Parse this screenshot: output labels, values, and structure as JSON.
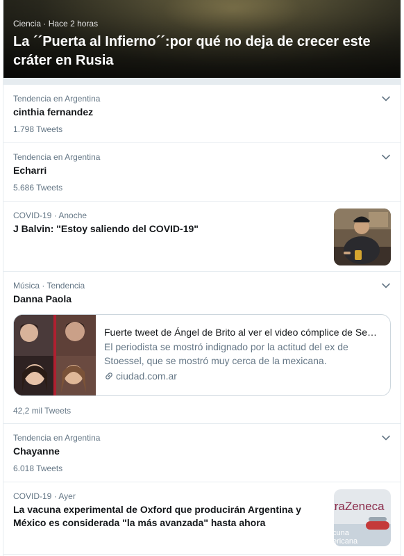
{
  "hero": {
    "category": "Ciencia",
    "separator": "·",
    "time": "Hace 2 horas",
    "title": "La ´´Puerta al Infierno´´:por qué no deja de crecer este cráter en Rusia"
  },
  "trends": [
    {
      "context": "Tendencia en Argentina",
      "name": "cinthia fernandez",
      "tweets": "1.798 Tweets",
      "icon": "chevron-down-icon"
    },
    {
      "context": "Tendencia en Argentina",
      "name": "Echarri",
      "tweets": "5.686 Tweets",
      "icon": "chevron-down-icon"
    }
  ],
  "news1": {
    "category": "COVID-19",
    "separator": "·",
    "time": "Anoche",
    "title": "J Balvin: \"Estoy saliendo del COVID-19\""
  },
  "trend_music": {
    "context": "Música · Tendencia",
    "name": "Danna Paola",
    "tweets": "42,2 mil Tweets",
    "card": {
      "title": "Fuerte tweet de Ángel de Brito al ver el video cómplice de Se…",
      "description": "El periodista se mostró indignado por la actitud del ex de Stoessel, que se mostró muy cerca de la mexicana.",
      "link": "ciudad.com.ar",
      "link_icon": "link-icon"
    }
  },
  "trend_last": {
    "context": "Tendencia en Argentina",
    "name": "Chayanne",
    "tweets": "6.018 Tweets"
  },
  "news2": {
    "category": "COVID-19",
    "separator": "·",
    "time": "Ayer",
    "title": "La vacuna experimental de Oxford que producirán Argentina y México es considerada \"la más avanzada\" hasta ahora",
    "thumb_text_1": "traZeneca",
    "thumb_text_2": "cuna",
    "thumb_text_3": "ericana"
  },
  "colors": {
    "secondary_text": "#657786",
    "primary_text": "#14171a",
    "divider": "#e6ecf0",
    "accent": "#1da1f2"
  }
}
